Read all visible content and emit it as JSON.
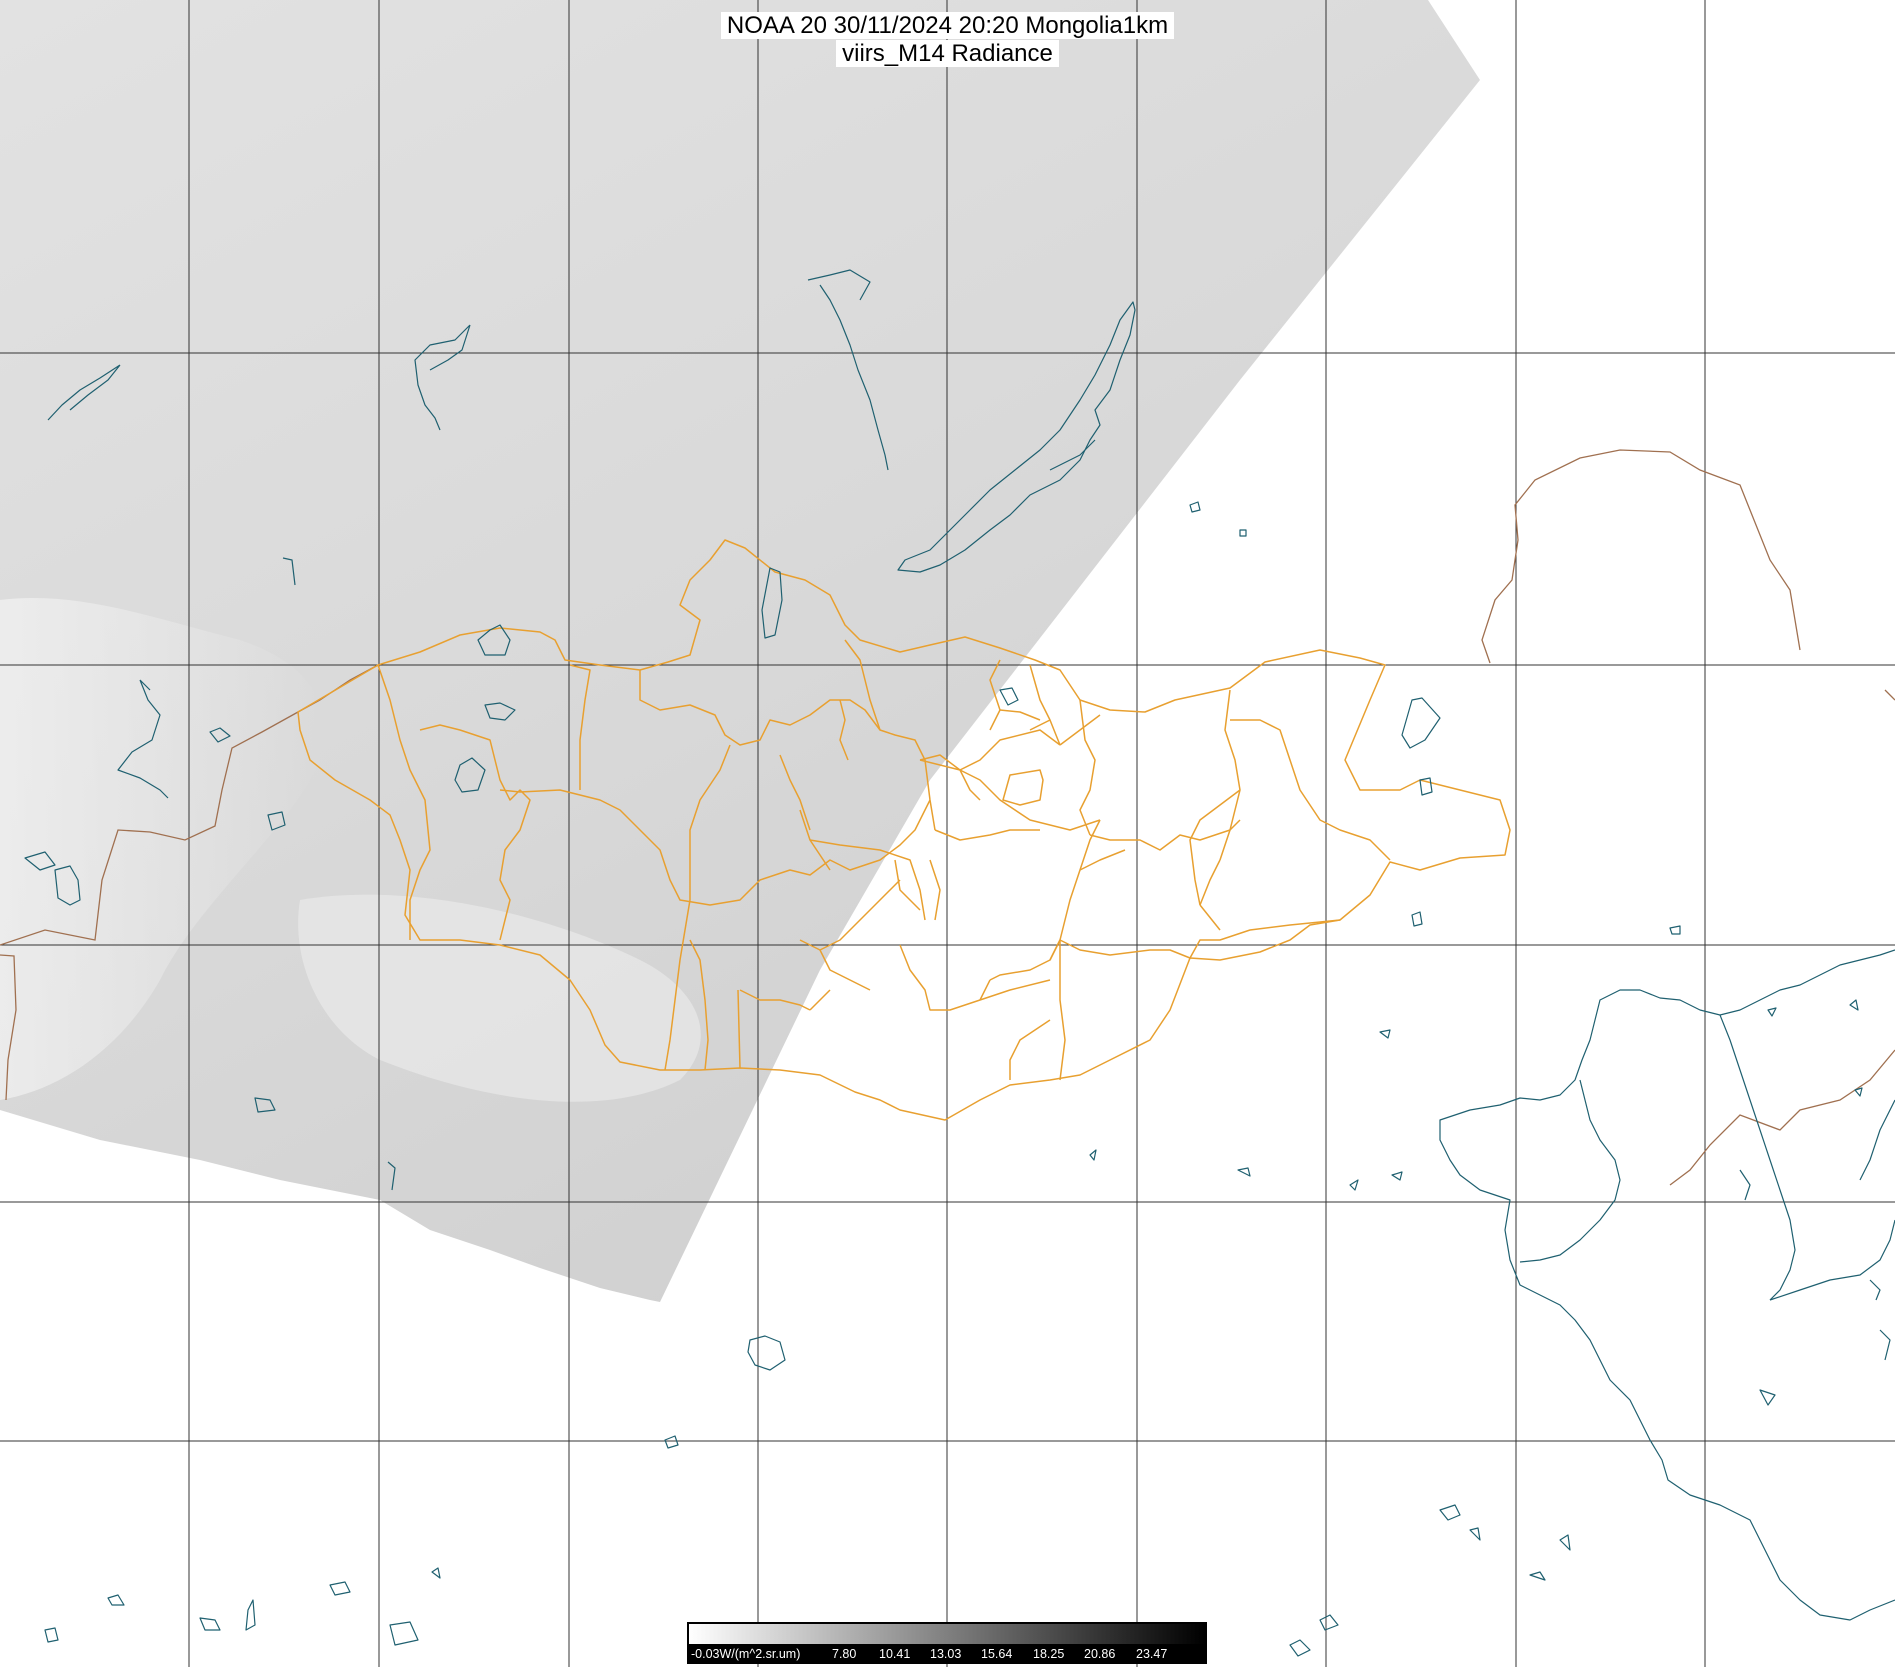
{
  "title": {
    "line1": "NOAA 20 30/11/2024 20:20 Mongolia1km",
    "line2": "viirs_M14 Radiance"
  },
  "colors": {
    "grid": "#333333",
    "aimag_borders": "#e8a030",
    "country_borders": "#a07050",
    "coastline": "#1f6070",
    "swath_light": "#e4e4e4",
    "swath_dark": "#d2d2d2"
  },
  "colorbar": {
    "unit_label": "-0.03W/(m^2.sr.um)",
    "tick_labels": [
      "7.80",
      "10.41",
      "13.03",
      "15.64",
      "18.25",
      "20.86",
      "23.47"
    ]
  }
}
